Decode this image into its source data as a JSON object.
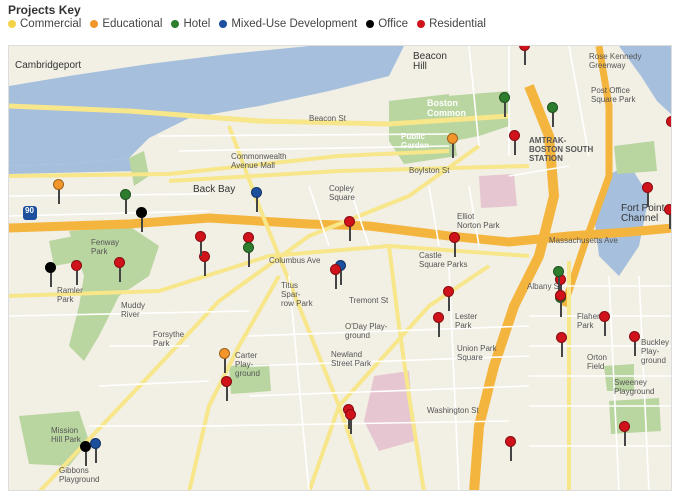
{
  "key": {
    "title": "Projects Key",
    "categories": [
      {
        "label": "Commercial",
        "color": "#f3d34a"
      },
      {
        "label": "Educational",
        "color": "#f2952a"
      },
      {
        "label": "Hotel",
        "color": "#2e7d2e"
      },
      {
        "label": "Mixed-Use Development",
        "color": "#1c4f9c"
      },
      {
        "label": "Office",
        "color": "#000000"
      },
      {
        "label": "Residential",
        "color": "#d0121b"
      }
    ]
  },
  "map": {
    "neighborhoods": {
      "cambridgeport": "Cambridgeport",
      "back_bay": "Back Bay",
      "beacon_hill": "Beacon\nHill",
      "fort_point": "Fort Point\nChannel",
      "amtrak": "AMTRAK-\nBOSTON SOUTH\nSTATION",
      "muddy_river": "Muddy\nRiver",
      "fenway_park": "Fenway\nPark",
      "ramler_park": "Ramler\nPark",
      "forsythe_park": "Forsythe\nPark",
      "boston_common": "Boston\nCommon",
      "public_garden": "Public\nGarden",
      "castle_square": "Castle\nSquare Parks",
      "titus_sparrow": "Titus\nSpar-\nrow Park",
      "carter_playground": "Carter\nPlay-\nground",
      "orton_field": "Orton\nField",
      "sweeney_playground": "Sweeney\nPlayground",
      "buckley_playground": "Buckley\nPlay-\nground",
      "gibbons_playground": "Gibbons\nPlayground",
      "mission_hill": "Mission\nHill Park",
      "flaherty_park": "Flaherty\nPark",
      "lester_park": "Lester\nPark",
      "union_park": "Union Park\nSquare",
      "elliot_norton": "Elliot\nNorton Park",
      "rose_kennedy": "Rose Kennedy\nGreenway",
      "comm_ave_mall": "Commonwealth\nAvenue Mall",
      "newland_park": "Newland\nStreet Park",
      "copley": "Copley\nSquare",
      "o_day": "O'Day Play-\nground",
      "post_office": "Post Office\nSquare Park"
    },
    "streets": {
      "beacon_st": "Beacon St",
      "boylston_st": "Boylston St",
      "columbus_ave": "Columbus Ave",
      "tremont_st": "Tremont St",
      "washington_st": "Washington St",
      "mass_ave": "Massachusetts Ave",
      "albany_st": "Albany St"
    },
    "highway_shield": "90"
  },
  "pins": [
    {
      "category": "Educational",
      "color": "#f2952a"
    },
    {
      "category": "Hotel",
      "color": "#2e7d2e"
    },
    {
      "category": "Office",
      "color": "#000000"
    },
    {
      "category": "Mixed-Use Development",
      "color": "#1c4f9c"
    },
    {
      "category": "Residential",
      "color": "#d0121b"
    },
    {
      "category": "Hotel",
      "color": "#2e7d2e"
    },
    {
      "category": "Residential",
      "color": "#d0121b"
    },
    {
      "category": "Office",
      "color": "#000000"
    },
    {
      "category": "Residential",
      "color": "#d0121b"
    },
    {
      "category": "Residential",
      "color": "#d0121b"
    },
    {
      "category": "Residential",
      "color": "#d0121b"
    },
    {
      "category": "Mixed-Use Development",
      "color": "#1c4f9c"
    },
    {
      "category": "Hotel",
      "color": "#2e7d2e"
    },
    {
      "category": "Residential",
      "color": "#d0121b"
    },
    {
      "category": "Educational",
      "color": "#f2952a"
    },
    {
      "category": "Residential",
      "color": "#d0121b"
    },
    {
      "category": "Hotel",
      "color": "#2e7d2e"
    },
    {
      "category": "Residential",
      "color": "#d0121b"
    },
    {
      "category": "Residential",
      "color": "#d0121b"
    },
    {
      "category": "Hotel",
      "color": "#2e7d2e"
    },
    {
      "category": "Residential",
      "color": "#d0121b"
    },
    {
      "category": "Residential",
      "color": "#d0121b"
    },
    {
      "category": "Residential",
      "color": "#d0121b"
    },
    {
      "category": "Residential",
      "color": "#d0121b"
    },
    {
      "category": "Residential",
      "color": "#d0121b"
    },
    {
      "category": "Residential",
      "color": "#d0121b"
    },
    {
      "category": "Residential",
      "color": "#d0121b"
    },
    {
      "category": "Hotel",
      "color": "#2e7d2e"
    },
    {
      "category": "Residential",
      "color": "#d0121b"
    },
    {
      "category": "Residential",
      "color": "#d0121b"
    },
    {
      "category": "Residential",
      "color": "#d0121b"
    },
    {
      "category": "Residential",
      "color": "#d0121b"
    },
    {
      "category": "Educational",
      "color": "#f2952a"
    },
    {
      "category": "Residential",
      "color": "#d0121b"
    },
    {
      "category": "Residential",
      "color": "#d0121b"
    },
    {
      "category": "Residential",
      "color": "#d0121b"
    },
    {
      "category": "Office",
      "color": "#000000"
    },
    {
      "category": "Mixed-Use Development",
      "color": "#1c4f9c"
    },
    {
      "category": "Residential",
      "color": "#d0121b"
    },
    {
      "category": "Residential",
      "color": "#d0121b"
    }
  ]
}
